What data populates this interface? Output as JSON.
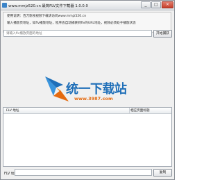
{
  "window": {
    "title": "www.mmjz520.cn 最简FLV文件下载器 1.0.0.0",
    "minimize": "_",
    "maximize": "□",
    "close": "×"
  },
  "notice": {
    "line1": "使用说明：百万影视视频下载请访问www.mmjz520.cn",
    "line2": "输入播放页地址，如flv播放地址，程序会自动捕获到flv的URL地址，视频必须处于播放状态"
  },
  "url_bar": {
    "placeholder": "请输入flv播放页面的地址",
    "parse_label": "开始捕获"
  },
  "watermark": {
    "name": "统一下载站",
    "url": "www.3987.com"
  },
  "list": {
    "columns": [
      "FLV 地址",
      "相应页面标题"
    ]
  },
  "footer": {
    "flv_label": "FLV 地址",
    "copy_label": "复制"
  }
}
